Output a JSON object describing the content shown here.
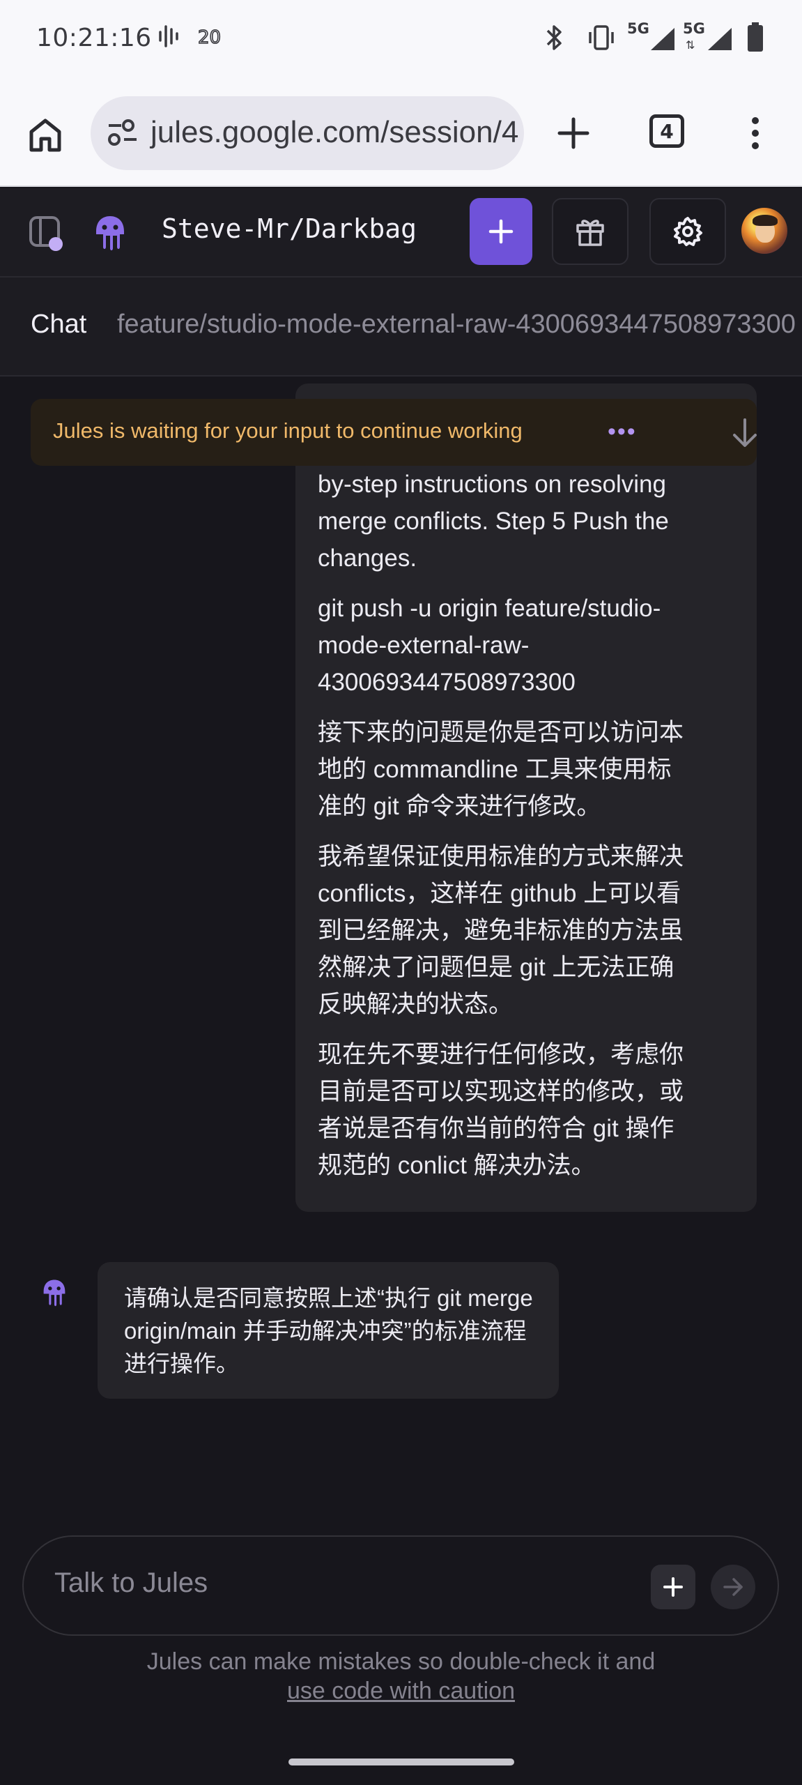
{
  "status_bar": {
    "time": "10:21:16",
    "network_a": "5G",
    "network_b": "5G",
    "icons": [
      "audio-icon",
      "hd-voice-icon",
      "bluetooth-icon",
      "vibrate-icon",
      "signal-icon",
      "battery-icon"
    ]
  },
  "browser": {
    "url": "jules.google.com/session/4",
    "tab_count": "4",
    "icons": [
      "home-icon",
      "site-settings-icon",
      "new-tab-icon",
      "tabs-icon",
      "more-icon"
    ]
  },
  "app_header": {
    "repo": "Steve-Mr/Darkbag",
    "icons": [
      "sidebar-toggle-icon",
      "jules-logo-icon",
      "plus-icon",
      "gift-icon",
      "gear-icon",
      "avatar"
    ],
    "accent_color": "#6f52d9"
  },
  "subheader": {
    "chat_label": "Chat",
    "branch": "feature/studio-mode-external-raw-4300693447508973300"
  },
  "banner": {
    "text": "Jules is waiting for your input to continue working",
    "dots": "•••",
    "text_color": "#f0b96a"
  },
  "messages": {
    "user_paragraphs": [
      "by-step instructions on resolving merge conflicts. Step 5 Push the changes.",
      "git push -u origin feature/studio-mode-external-raw-4300693447508973300",
      "接下来的问题是你是否可以访问本地的 commandline 工具来使用标准的 git 命令来进行修改。",
      "我希望保证使用标准的方式来解决 conflicts，这样在 github 上可以看到已经解决，避免非标准的方法虽然解决了问题但是 git 上无法正确反映解决的状态。",
      "现在先不要进行任何修改，考虑你目前是否可以实现这样的修改，或者说是否有你当前的符合 git 操作规范的 conlict 解决办法。"
    ],
    "bot_text": "请确认是否同意按照上述“执行 git merge origin/main 并手动解决冲突”的标准流程进行操作。"
  },
  "composer": {
    "placeholder": "Talk to Jules"
  },
  "disclaimer": {
    "text": "Jules can make mistakes so double-check it and",
    "link": "use code with caution"
  }
}
